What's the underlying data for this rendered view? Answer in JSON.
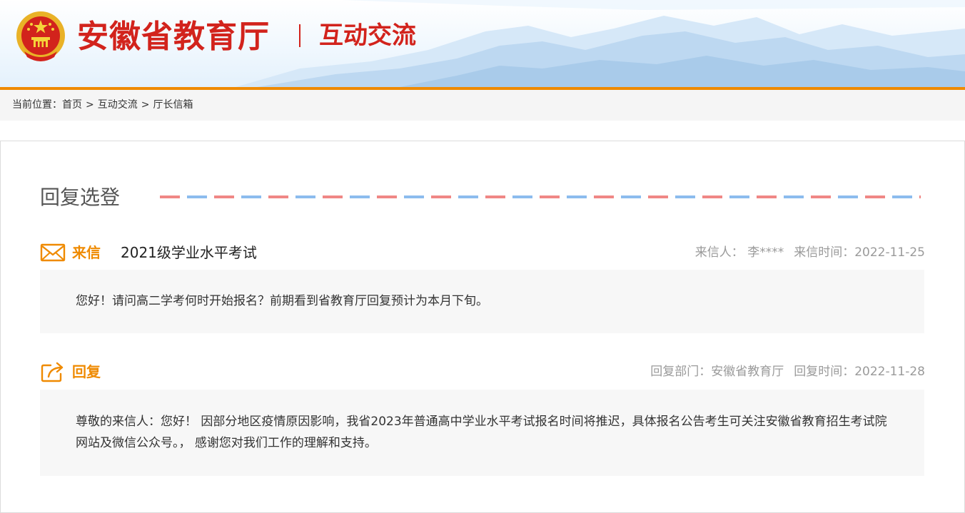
{
  "header": {
    "site_title": "安徽省教育厅",
    "section_title": "互动交流",
    "emblem_icon": "national-emblem-icon",
    "brand_color": "#d2231c",
    "accent_color": "#ef8a00"
  },
  "breadcrumb": {
    "prefix": "当前位置：",
    "items": [
      "首页",
      "互动交流",
      "厅长信箱"
    ],
    "separator": ">"
  },
  "panel": {
    "heading": "回复选登"
  },
  "letter": {
    "icon": "envelope-icon",
    "tag": "来信",
    "subject": "2021级学业水平考试",
    "sender_label": "来信人：",
    "sender": "李****",
    "date_label": "来信时间：",
    "date": "2022-11-25",
    "body": "您好！请问高二学考何时开始报名？前期看到省教育厅回复预计为本月下旬。"
  },
  "reply": {
    "icon": "share-reply-icon",
    "tag": "回复",
    "dept_label": "回复部门：",
    "dept": "安徽省教育厅",
    "date_label": "回复时间：",
    "date": "2022-11-28",
    "body": "尊敬的来信人：您好！ 因部分地区疫情原因影响，我省2023年普通高中学业水平考试报名时间将推迟，具体报名公告考生可关注安徽省教育招生考试院网站及微信公众号。， 感谢您对我们工作的理解和支持。"
  }
}
